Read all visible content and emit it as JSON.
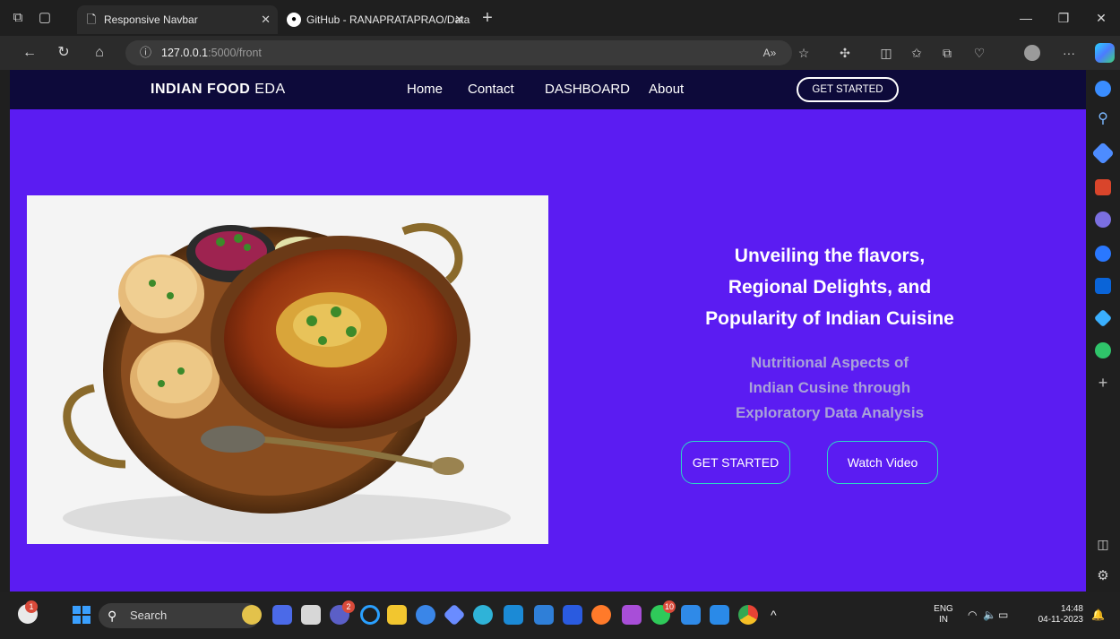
{
  "browser": {
    "tabs": [
      {
        "title": "Responsive Navbar",
        "active": true
      },
      {
        "title": "GitHub - RANAPRATAPRAO/Data",
        "active": false
      }
    ],
    "url_host": "127.0.0.1",
    "url_path": ":5000/front",
    "new_tab_glyph": "+",
    "close_glyph": "✕",
    "more_glyph": "···"
  },
  "site": {
    "brand_bold": "INDIAN FOOD",
    "brand_light": "EDA",
    "nav_links": [
      "Home",
      "Contact",
      "DASHBOARD",
      "About"
    ],
    "nav_cta": "GET STARTED",
    "hero_title_lines": [
      "Unveiling the flavors,",
      "Regional Delights, and",
      "Popularity of Indian Cuisine"
    ],
    "hero_subtitle_lines": [
      "Nutritional Aspects of",
      "Indian Cusine through",
      "Exploratory Data Analysis"
    ],
    "buttons": {
      "get_started": "GET STARTED",
      "watch_video": "Watch Video"
    },
    "colors": {
      "page_bg": "#5b1cf2",
      "nav_bg": "#0d0a3a",
      "button_border": "#2dd4c7"
    }
  },
  "taskbar": {
    "search_placeholder": "Search",
    "weather_badge": "1",
    "teams_badge": "2",
    "whatsapp_badge": "10",
    "language_top": "ENG",
    "language_bottom": "IN",
    "time": "14:48",
    "date": "04-11-2023",
    "overflow_glyph": "^"
  }
}
